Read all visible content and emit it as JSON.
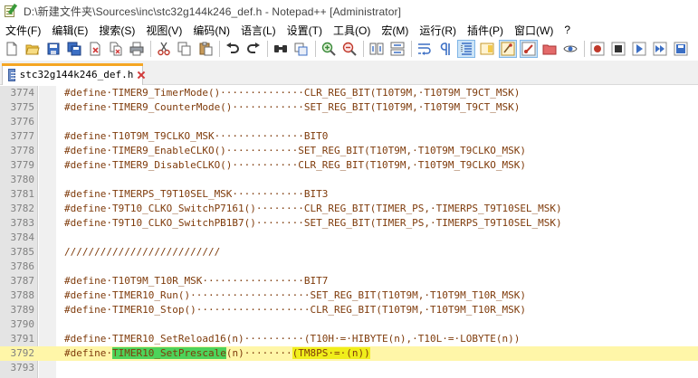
{
  "window": {
    "title": "D:\\新建文件夹\\Sources\\inc\\stc32g144k246_def.h - Notepad++ [Administrator]"
  },
  "menu": [
    "文件(F)",
    "编辑(E)",
    "搜索(S)",
    "视图(V)",
    "编码(N)",
    "语言(L)",
    "设置(T)",
    "工具(O)",
    "宏(M)",
    "运行(R)",
    "插件(P)",
    "窗口(W)",
    "?"
  ],
  "toolbar_icons": [
    "new-file-icon",
    "open-file-icon",
    "save-icon",
    "save-all-icon",
    "close-icon",
    "close-all-icon",
    "print-icon",
    "cut-icon",
    "copy-icon",
    "paste-icon",
    "undo-icon",
    "redo-icon",
    "find-icon",
    "replace-icon",
    "zoom-in-icon",
    "zoom-out-icon",
    "sync-vertical-icon",
    "sync-horizontal-icon",
    "word-wrap-icon",
    "show-all-chars-icon",
    "indent-guide-icon",
    "doc-map-icon",
    "function-list-icon",
    "folder-workspace-icon",
    "monitoring-icon",
    "eye-icon",
    "record-macro-icon",
    "stop-record-icon",
    "play-macro-icon",
    "run-macro-multiple-icon",
    "save-macro-icon"
  ],
  "tab": {
    "label": "stc32g144k246_def.h"
  },
  "colors": {
    "code_text": "#7f3b0b",
    "current_line": "#fff6a8",
    "highlight_green": "#4dd35a",
    "highlight_yellow": "#f0ee1b"
  },
  "lines": [
    {
      "num": "3774",
      "text": "#define·TIMER9_TimerMode()··············CLR_REG_BIT(T10T9M,·T10T9M_T9CT_MSK)"
    },
    {
      "num": "3775",
      "text": "#define·TIMER9_CounterMode()············SET_REG_BIT(T10T9M,·T10T9M_T9CT_MSK)"
    },
    {
      "num": "3776",
      "text": ""
    },
    {
      "num": "3777",
      "text": "#define·T10T9M_T9CLKO_MSK···············BIT0"
    },
    {
      "num": "3778",
      "text": "#define·TIMER9_EnableCLKO()············SET_REG_BIT(T10T9M,·T10T9M_T9CLKO_MSK)"
    },
    {
      "num": "3779",
      "text": "#define·TIMER9_DisableCLKO()···········CLR_REG_BIT(T10T9M,·T10T9M_T9CLKO_MSK)"
    },
    {
      "num": "3780",
      "text": ""
    },
    {
      "num": "3781",
      "text": "#define·TIMERPS_T9T10SEL_MSK············BIT3"
    },
    {
      "num": "3782",
      "text": "#define·T9T10_CLKO_SwitchP7161()········CLR_REG_BIT(TIMER_PS,·TIMERPS_T9T10SEL_MSK)"
    },
    {
      "num": "3783",
      "text": "#define·T9T10_CLKO_SwitchPB1B7()········SET_REG_BIT(TIMER_PS,·TIMERPS_T9T10SEL_MSK)"
    },
    {
      "num": "3784",
      "text": ""
    },
    {
      "num": "3785",
      "text": "//////////////////////////"
    },
    {
      "num": "3786",
      "text": ""
    },
    {
      "num": "3787",
      "text": "#define·T10T9M_T10R_MSK·················BIT7"
    },
    {
      "num": "3788",
      "text": "#define·TIMER10_Run()····················SET_REG_BIT(T10T9M,·T10T9M_T10R_MSK)"
    },
    {
      "num": "3789",
      "text": "#define·TIMER10_Stop()···················CLR_REG_BIT(T10T9M,·T10T9M_T10R_MSK)"
    },
    {
      "num": "3790",
      "text": ""
    },
    {
      "num": "3791",
      "text": "#define·TIMER10_SetReload16(n)··········(T10H·=·HIBYTE(n),·T10L·=·LOBYTE(n))"
    },
    {
      "num": "3792",
      "pre": "#define·",
      "green": "TIMER10_SetPrescale",
      "mid": "(n)········",
      "yellow": "(TM8PS·=·(n))",
      "current": true
    },
    {
      "num": "3793",
      "text": ""
    }
  ]
}
